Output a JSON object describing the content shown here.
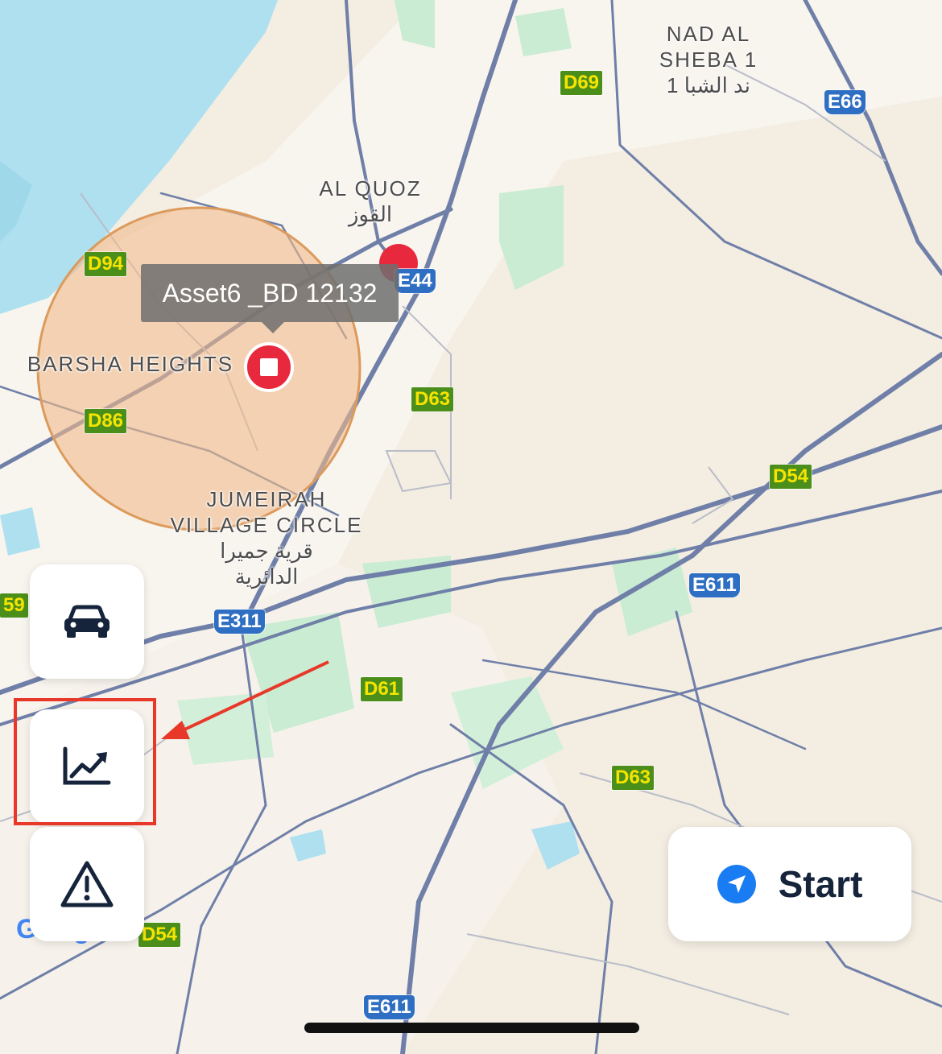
{
  "map": {
    "place_labels": {
      "nad_al_sheba": "NAD AL\nSHEBA 1\nند الشبا 1",
      "al_quoz": "AL QUOZ\nالقوز",
      "barsha_heights": "BARSHA HEIGHTS",
      "jvc": "JUMEIRAH\nVILLAGE CIRCLE\nقرية جميرا\nالدائرية"
    },
    "road_shields": {
      "d69": "D69",
      "e66": "E66",
      "d94": "D94",
      "e44": "E44",
      "d63_top": "D63",
      "d86": "D86",
      "d54": "D54",
      "e611_mid": "E611",
      "e311": "E311",
      "d61": "D61",
      "d63_bottom": "D63",
      "d54_bottom": "D54",
      "e611_bottom": "E611",
      "edge_59": "59"
    },
    "asset_tooltip": "Asset6 _BD 12132",
    "google_attribution": "Google"
  },
  "controls": {
    "vehicle_icon": "car-icon",
    "analytics_icon": "trending-up-icon",
    "alerts_icon": "warning-icon",
    "start_label": "Start"
  },
  "colors": {
    "water": "#aee0f0",
    "land": "#f3ede2",
    "park": "#c9ecd3",
    "road": "#6f7fa8",
    "geofence": "#f0b98a",
    "marker_red": "#e8283c",
    "highlight_red": "#e8382a",
    "accent_blue": "#1a7cf3"
  }
}
